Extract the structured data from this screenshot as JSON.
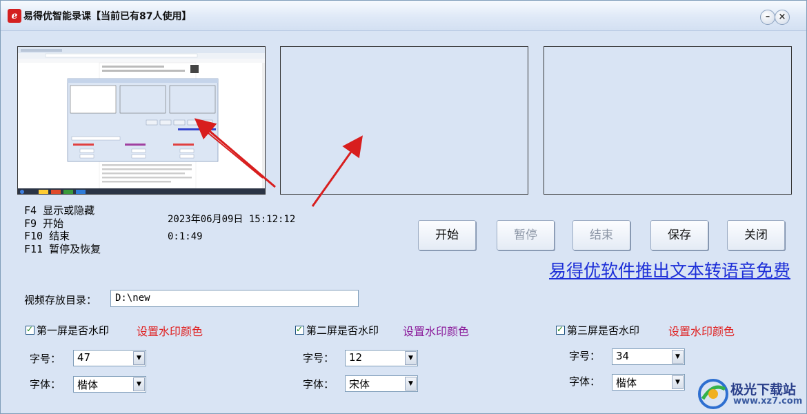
{
  "window": {
    "title": "易得优智能录课【当前已有87人使用】",
    "logo_icon": "app-logo-icon",
    "minimize_glyph": "–",
    "close_glyph": "×"
  },
  "hotkeys": [
    "F4  显示或隐藏",
    "F9  开始",
    "F10 结束",
    "F11 暂停及恢复"
  ],
  "status": {
    "datetime": "2023年06月09日 15:12:12",
    "elapsed": "0:1:49"
  },
  "buttons": {
    "start": "开始",
    "pause": "暂停",
    "stop": "结束",
    "save": "保存",
    "close": "关闭"
  },
  "marquee": "易得优软件推出文本转语音免费",
  "directory": {
    "label": "视频存放目录：",
    "value": "D:\\new"
  },
  "screens": [
    {
      "watermark_label": "第一屏是否水印",
      "color_link": "设置水印颜色",
      "color": "#e02020",
      "size_label": "字号：",
      "size_value": "47",
      "font_label": "字体：",
      "font_value": "楷体"
    },
    {
      "watermark_label": "第二屏是否水印",
      "color_link": "设置水印颜色",
      "color": "#8a1a9a",
      "size_label": "字号：",
      "size_value": "12",
      "font_label": "字体：",
      "font_value": "宋体"
    },
    {
      "watermark_label": "第三屏是否水印",
      "color_link": "设置水印颜色",
      "color": "#e02020",
      "size_label": "字号：",
      "size_value": "34",
      "font_label": "字体：",
      "font_value": "楷体"
    }
  ],
  "site_watermark": {
    "name": "极光下载站",
    "url": "www.xz7.com"
  },
  "colors": {
    "accent_link": "#1d2fd8",
    "arrow": "#d81e1e"
  }
}
